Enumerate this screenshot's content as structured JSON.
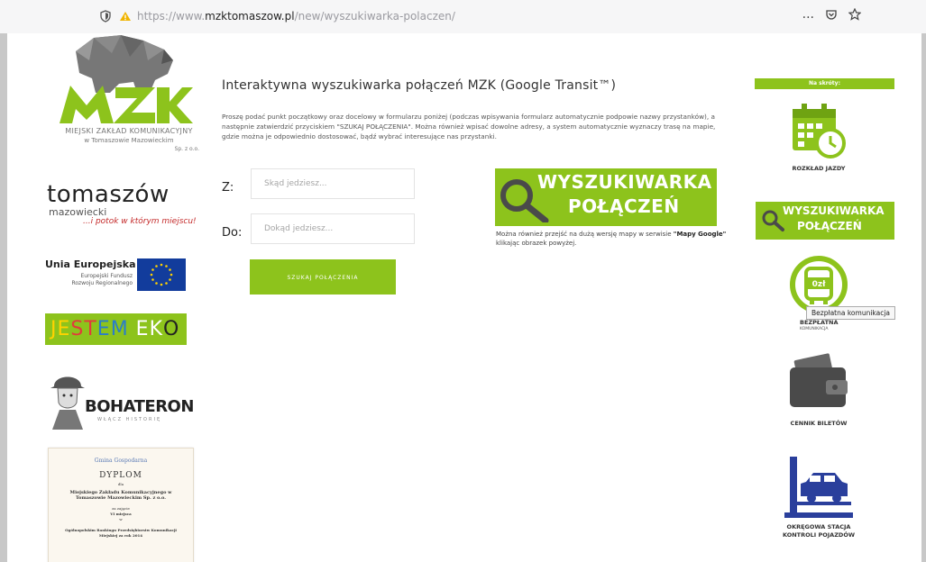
{
  "browser": {
    "url_prefix": "https://www.",
    "url_domain": "mzktomaszow.pl",
    "url_path": "/new/wyszukiwarka-polaczen/",
    "more_icon": "...",
    "pocket_icon": "pocket-icon",
    "star_icon": "star-icon"
  },
  "left": {
    "mzk_line1": "MIEJSKI ZAKŁAD KOMUNIKACYJNY",
    "mzk_line2": "w Tomaszowie Mazowieckim",
    "mzk_line3": "Sp. z o.o.",
    "tomaszow_main": "tomaszów",
    "tomaszow_sub": "mazowiecki",
    "tomaszow_slogan": "...i potok w którym miejscu!",
    "ue_title": "Unia Europejska",
    "ue_line1": "Europejski Fundusz",
    "ue_line2": "Rozwoju Regionalnego",
    "eko_parts": [
      "JE",
      "ST",
      "EM ",
      "EK",
      "O"
    ],
    "bohater_title": "BOHATERON",
    "bohater_sub": "WŁĄCZ HISTORIĘ",
    "dyplom_logo": "Gmina Gospodarna",
    "dyplom_title": "DYPLOM",
    "dyplom_for": "dla",
    "dyplom_recipient": "Miejskiego Zakładu Komunikacyjnego w Tomaszowie Mazowieckim Sp. z o.o.",
    "dyplom_place_label": "za zajęcie",
    "dyplom_place": "VI miejsca",
    "dyplom_text": "w",
    "dyplom_ranking": "Ogólnopolskim Rankingu Przedsiębiorstw Komunikacji Miejskiej za rok 2014"
  },
  "main": {
    "title": "Interaktywna wyszukiwarka połączeń MZK (Google Transit™)",
    "intro": "Proszę podać punkt początkowy oraz docelowy w formularzu poniżej (podczas wpisywania formularz automatycznie podpowie nazwy przystanków), a następnie zatwierdzić przyciskiem \"SZUKAJ POŁĄCZENIA\". Można również wpisać dowolne adresy, a system automatycznie wyznaczy trasę na mapie, gdzie można je odpowiednio dostosować, bądź wybrać interesujące nas przystanki.",
    "from_label": "Z:",
    "from_placeholder": "Skąd jedziesz...",
    "to_label": "Do:",
    "to_placeholder": "Dokąd jedziesz...",
    "search_button": "SZUKAJ POŁĄCZENIA",
    "banner_line1": "WYSZUKIWARKA",
    "banner_line2": "POŁĄCZEŃ",
    "map_note_before": "Można również przejść na dużą wersję mapy w serwisie ",
    "map_note_bold": "\"Mapy Google\"",
    "map_note_after": " klikając obrazek powyżej."
  },
  "right": {
    "shortcuts_title": "Na skróty:",
    "rozklad": "ROZKŁAD JAZDY",
    "banner_line1": "WYSZUKIWARKA",
    "banner_line2": "POŁĄCZEŃ",
    "bus_badge": "0zł",
    "bezplatna": "BEZPŁATNA",
    "komunikacja": "KOMUNIKACJA",
    "tooltip": "Bezpłatna komunikacja",
    "cennik": "CENNIK BILETÓW",
    "skp_line1": "OKRĘGOWA STACJA",
    "skp_line2": "KONTROLI POJAZDÓW"
  },
  "colors": {
    "accent_green": "#8dc31c",
    "logo_gray": "#7b7b7b",
    "eu_blue": "#123c9c"
  }
}
